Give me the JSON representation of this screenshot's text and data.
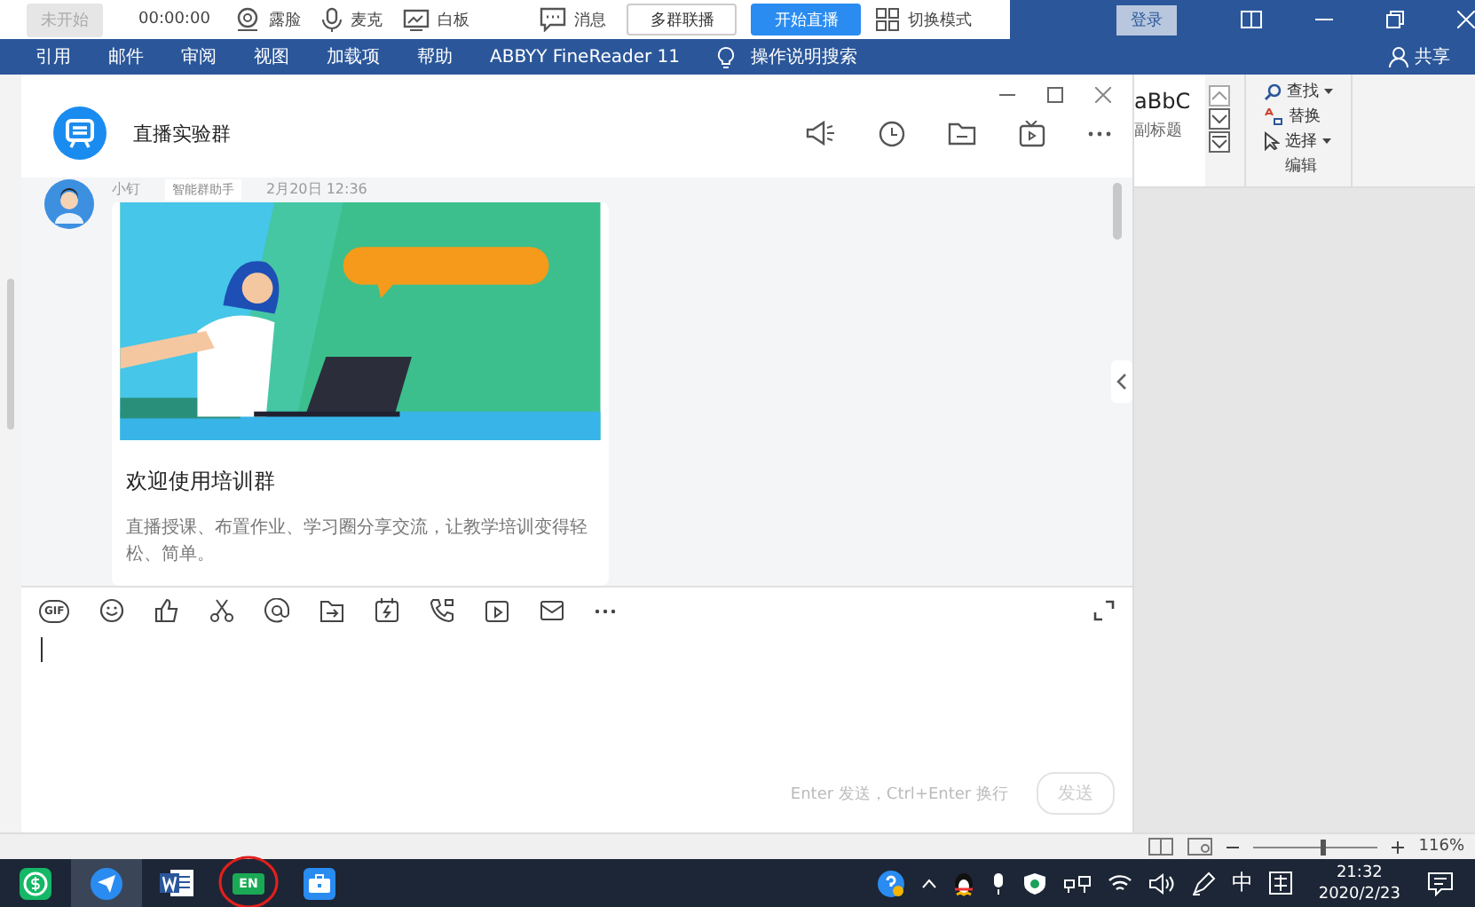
{
  "live_toolbar": {
    "status_button": {
      "label": "未开始",
      "disabled": true
    },
    "timer": "00:00:00",
    "tools": [
      {
        "kind": "camera",
        "label": "露脸"
      },
      {
        "kind": "mic",
        "label": "麦克"
      },
      {
        "kind": "board",
        "label": "白板"
      },
      {
        "kind": "message",
        "label": "消息"
      }
    ],
    "buttons": [
      {
        "label": "多群联播",
        "kind": "secondary"
      },
      {
        "label": "开始直播",
        "kind": "primary"
      }
    ],
    "mode_switch": "切换模式"
  },
  "word_titlebar": {
    "login_button": "登录"
  },
  "ribbon_tabs": [
    "引用",
    "邮件",
    "审阅",
    "视图",
    "加载项",
    "帮助",
    "ABBYY FineReader 11"
  ],
  "tell_me": "操作说明搜索",
  "share": "共享",
  "styles_gallery": {
    "sample": "aBbC",
    "style_name": "副标题"
  },
  "editing_group": {
    "title": "编辑",
    "items": [
      {
        "kind": "find",
        "label": "查找",
        "dropdown": true
      },
      {
        "kind": "replace",
        "label": "替换",
        "dropdown": false
      },
      {
        "kind": "select",
        "label": "选择",
        "dropdown": true
      }
    ]
  },
  "chat": {
    "title": "直播实验群",
    "message": {
      "sender": "小钉",
      "tag": "智能群助手",
      "time": "2月20日 12:36",
      "card": {
        "kind": "picture",
        "title": "欢迎使用培训群",
        "description": "直播授课、布置作业、学习圈分享交流，让教学培训变得轻松、简单。"
      }
    },
    "composer": {
      "gif_label": "GIF",
      "hint": "Enter 发送，Ctrl+Enter 换行",
      "send_button": {
        "label": "发送",
        "disabled": true
      }
    }
  },
  "status_bar": {
    "zoom": {
      "level": 0.55,
      "reading": "116%"
    }
  },
  "taskbar": {
    "apps": [
      {
        "kind": "money",
        "selected": false
      },
      {
        "kind": "ding",
        "selected": true
      },
      {
        "kind": "word",
        "selected": false
      },
      {
        "kind": "en",
        "label": "EN",
        "selected": false,
        "circled": true
      },
      {
        "kind": "case",
        "selected": false
      }
    ],
    "input_mode": "中",
    "time": "21:32",
    "date": "2020/2/23"
  }
}
